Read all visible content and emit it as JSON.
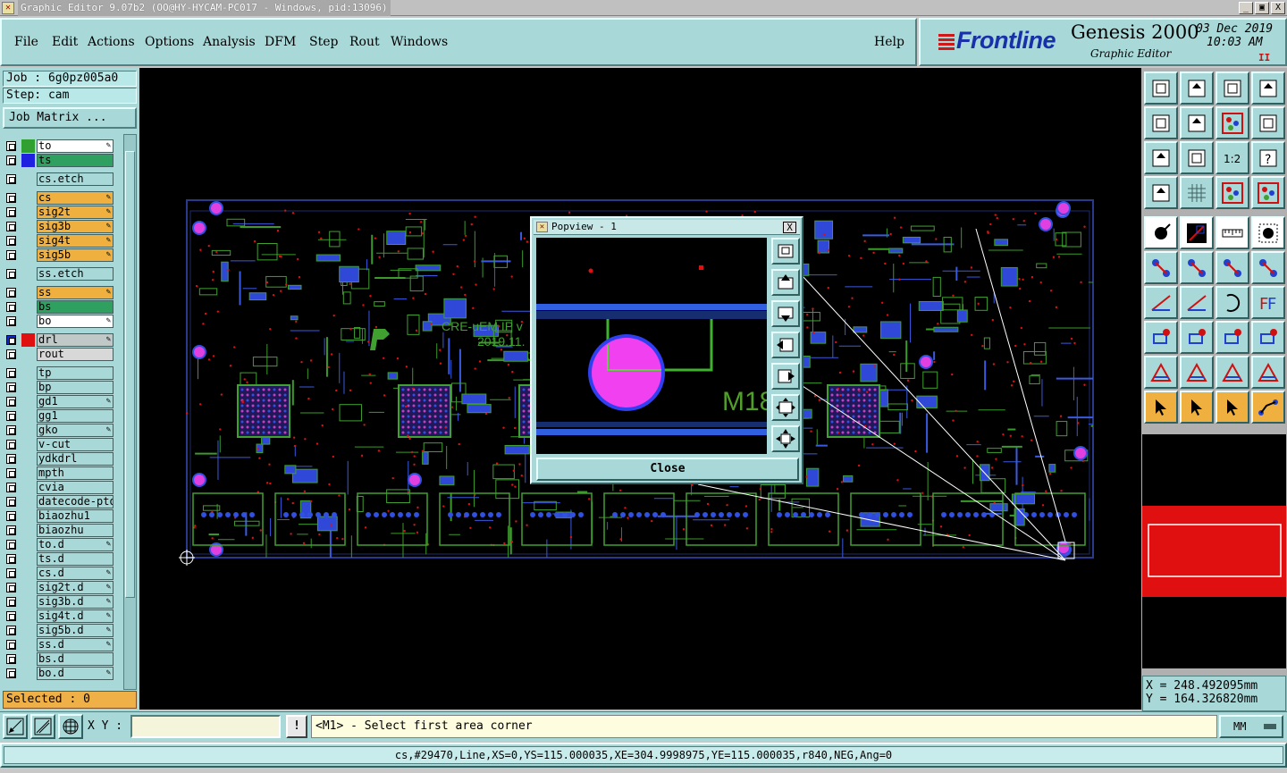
{
  "window": {
    "title": "Graphic Editor 9.07b2 (OO@HY-HYCAM-PC017 - Windows, pid:13096)",
    "minimize": "_",
    "maximize": "▣",
    "close": "X"
  },
  "menu": {
    "items": [
      "File",
      "Edit",
      "Actions",
      "Options",
      "Analysis",
      "DFM",
      "Step",
      "Rout",
      "Windows"
    ],
    "help": "Help"
  },
  "brand": {
    "logo": "Frontline",
    "product": "Genesis 2000",
    "subtitle": "Graphic Editor",
    "date": "03 Dec 2019",
    "time": "10:03 AM",
    "pause": "II"
  },
  "job": {
    "job_label": "Job : 6g0pz005a0",
    "step_label": "Step: cam",
    "matrix_button": "Job Matrix ..."
  },
  "layers": [
    {
      "name": "to",
      "bg": "#ffffff",
      "color": "#30a030",
      "pen": true
    },
    {
      "name": "ts",
      "bg": "#30a060",
      "color": "#2020e0",
      "pen": false
    },
    {
      "name": "cs.etch",
      "bg": "#a8d8d8",
      "color": "",
      "pen": false,
      "gap": true
    },
    {
      "name": "cs",
      "bg": "#f0b040",
      "color": "",
      "pen": true,
      "gap": true
    },
    {
      "name": "sig2t",
      "bg": "#f0b040",
      "color": "",
      "pen": true
    },
    {
      "name": "sig3b",
      "bg": "#f0b040",
      "color": "",
      "pen": true
    },
    {
      "name": "sig4t",
      "bg": "#f0b040",
      "color": "",
      "pen": true
    },
    {
      "name": "sig5b",
      "bg": "#f0b040",
      "color": "",
      "pen": true
    },
    {
      "name": "ss.etch",
      "bg": "#a8d8d8",
      "color": "",
      "pen": false,
      "gap": true
    },
    {
      "name": "ss",
      "bg": "#f0b040",
      "color": "",
      "pen": true,
      "gap": true
    },
    {
      "name": "bs",
      "bg": "#30a060",
      "color": "",
      "pen": false
    },
    {
      "name": "bo",
      "bg": "#ffffff",
      "color": "",
      "pen": true
    },
    {
      "name": "drl",
      "bg": "#c0c8c8",
      "color": "#e01010",
      "pen": true,
      "gap": true,
      "active": true
    },
    {
      "name": "rout",
      "bg": "#d8d8d8",
      "color": "",
      "pen": false
    },
    {
      "name": "tp",
      "bg": "#a8d8d8",
      "color": "",
      "pen": false,
      "gap": true
    },
    {
      "name": "bp",
      "bg": "#a8d8d8",
      "color": "",
      "pen": false
    },
    {
      "name": "gd1",
      "bg": "#a8d8d8",
      "color": "",
      "pen": true
    },
    {
      "name": "gg1",
      "bg": "#a8d8d8",
      "color": "",
      "pen": false
    },
    {
      "name": "gko",
      "bg": "#a8d8d8",
      "color": "",
      "pen": true
    },
    {
      "name": "v-cut",
      "bg": "#a8d8d8",
      "color": "",
      "pen": false
    },
    {
      "name": "ydkdrl",
      "bg": "#a8d8d8",
      "color": "",
      "pen": false
    },
    {
      "name": "mpth",
      "bg": "#a8d8d8",
      "color": "",
      "pen": false
    },
    {
      "name": "cvia",
      "bg": "#a8d8d8",
      "color": "",
      "pen": false
    },
    {
      "name": "datecode-pto",
      "bg": "#a8d8d8",
      "color": "",
      "pen": false
    },
    {
      "name": "biaozhu1",
      "bg": "#a8d8d8",
      "color": "",
      "pen": false
    },
    {
      "name": "biaozhu",
      "bg": "#a8d8d8",
      "color": "",
      "pen": false
    },
    {
      "name": "to.d",
      "bg": "#a8d8d8",
      "color": "",
      "pen": true
    },
    {
      "name": "ts.d",
      "bg": "#a8d8d8",
      "color": "",
      "pen": false
    },
    {
      "name": "cs.d",
      "bg": "#a8d8d8",
      "color": "",
      "pen": true
    },
    {
      "name": "sig2t.d",
      "bg": "#a8d8d8",
      "color": "",
      "pen": true
    },
    {
      "name": "sig3b.d",
      "bg": "#a8d8d8",
      "color": "",
      "pen": true
    },
    {
      "name": "sig4t.d",
      "bg": "#a8d8d8",
      "color": "",
      "pen": true
    },
    {
      "name": "sig5b.d",
      "bg": "#a8d8d8",
      "color": "",
      "pen": true
    },
    {
      "name": "ss.d",
      "bg": "#a8d8d8",
      "color": "",
      "pen": true
    },
    {
      "name": "bs.d",
      "bg": "#a8d8d8",
      "color": "",
      "pen": false
    },
    {
      "name": "bo.d",
      "bg": "#a8d8d8",
      "color": "",
      "pen": true
    }
  ],
  "selected": "Selected : 0",
  "board": {
    "text1": "CRE-uEM IP v",
    "text2": "2019.11."
  },
  "popview": {
    "title": "Popview - 1",
    "close_x": "X",
    "close_button": "Close",
    "label": "M18"
  },
  "coords": {
    "x": "X = 248.492095mm",
    "y": "Y = 164.326820mm"
  },
  "bottom": {
    "xy_label": "X Y :",
    "xy_value": "",
    "warn": "!",
    "prompt": "<M1> - Select first area corner",
    "units": "MM"
  },
  "status": "cs,#29470,Line,XS=0,YS=115.000035,XE=304.9998975,YE=115.000035,r840,NEG,Ang=0",
  "colors": {
    "panel": "#a8d8d8",
    "accent_orange": "#f0b040",
    "canvas": "#000000",
    "pad_magenta": "#e040e0",
    "copper_blue": "#3050e0",
    "silk_green": "#40a030",
    "overview_red": "#e01010"
  }
}
